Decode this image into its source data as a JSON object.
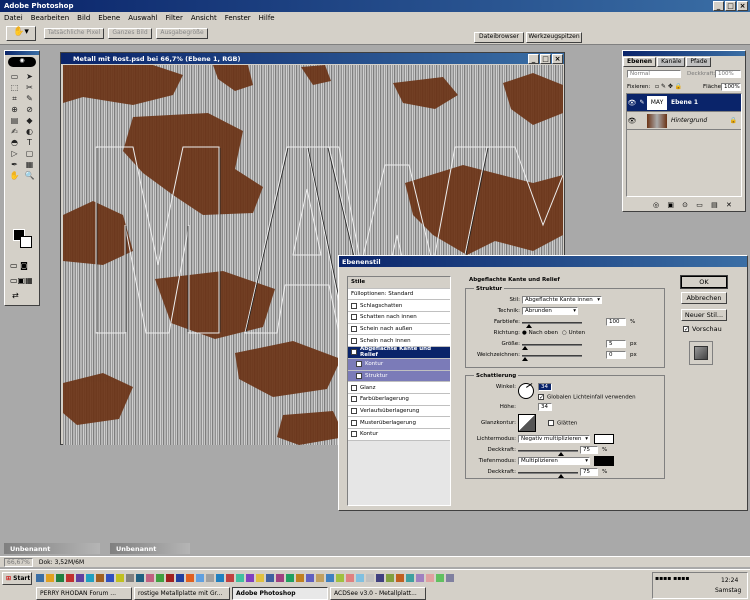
{
  "app": {
    "title": "Adobe Photoshop"
  },
  "menu": [
    "Datei",
    "Bearbeiten",
    "Bild",
    "Ebene",
    "Auswahl",
    "Filter",
    "Ansicht",
    "Fenster",
    "Hilfe"
  ],
  "options": {
    "btn1": "Tatsächliche Pixel",
    "btn2": "Ganzes Bild",
    "btn3": "Ausgabegröße",
    "tab1": "Dateibrowser",
    "tab2": "Werkzeugspitzen"
  },
  "doc": {
    "title": "Metall mit Rost.psd bei 66,7% (Ebene 1, RGB)"
  },
  "layers": {
    "tabs": [
      "Ebenen",
      "Kanäle",
      "Pfade"
    ],
    "mode": "Normal",
    "opacity_label": "Deckkraft:",
    "opacity": "100%",
    "fill_label": "Fläche",
    "fill": "100%",
    "lock_label": "Fixieren:",
    "items": [
      {
        "name": "Ebene 1",
        "thumb": "MAY"
      },
      {
        "name": "Hintergrund"
      }
    ]
  },
  "dialog": {
    "title": "Ebenenstil",
    "styles": [
      {
        "label": "Stile",
        "type": "header"
      },
      {
        "label": "Fülloptionen: Standard",
        "type": "plain"
      },
      {
        "label": "Schlagschatten",
        "type": "check",
        "checked": false
      },
      {
        "label": "Schatten nach innen",
        "type": "check",
        "checked": false
      },
      {
        "label": "Schein nach außen",
        "type": "check",
        "checked": false
      },
      {
        "label": "Schein nach innen",
        "type": "check",
        "checked": false
      },
      {
        "label": "Abgeflachte Kante und Relief",
        "type": "check",
        "checked": true,
        "selected": true
      },
      {
        "label": "Kontur",
        "type": "sub",
        "checked": false
      },
      {
        "label": "Struktur",
        "type": "sub",
        "checked": false
      },
      {
        "label": "Glanz",
        "type": "check",
        "checked": false
      },
      {
        "label": "Farbüberlagerung",
        "type": "check",
        "checked": false
      },
      {
        "label": "Verlaufsüberlagerung",
        "type": "check",
        "checked": false
      },
      {
        "label": "Musterüberlagerung",
        "type": "check",
        "checked": false
      },
      {
        "label": "Kontur",
        "type": "check",
        "checked": false
      }
    ],
    "section_title": "Abgeflachte Kante und Relief",
    "structure": {
      "title": "Struktur",
      "stil_label": "Stil:",
      "stil": "Abgeflachte Kante innen",
      "technik_label": "Technik:",
      "technik": "Abrunden",
      "tiefe_label": "Farbtiefe:",
      "tiefe": "100",
      "richtung_label": "Richtung:",
      "richtung_up": "Nach oben",
      "richtung_down": "Unten",
      "groesse_label": "Größe:",
      "groesse": "5",
      "weich_label": "Weichzeichnen:",
      "weich": "0",
      "px": "px",
      "pct": "%"
    },
    "shading": {
      "title": "Schattierung",
      "winkel_label": "Winkel:",
      "winkel": "34",
      "global_label": "Globalen Lichteinfall verwenden",
      "hoehe_label": "Höhe:",
      "hoehe": "34",
      "glanz_label": "Glanzkontur:",
      "glaetten_label": "Glätten",
      "licht_label": "Lichtermodus:",
      "licht": "Negativ multiplizieren",
      "deck_label": "Deckkraft:",
      "deck1": "75",
      "tiefen_label": "Tiefenmodus:",
      "tiefen": "Multiplizieren",
      "deck2": "75"
    },
    "buttons": {
      "ok": "OK",
      "cancel": "Abbrechen",
      "new_style": "Neuer Stil...",
      "preview": "Vorschau"
    }
  },
  "minimized": [
    "Unbenannt",
    "Unbenannt"
  ],
  "status": {
    "zoom": "66,67%",
    "doc": "Dok: 3,52M/6M"
  },
  "taskbar": {
    "start": "Start",
    "tasks": [
      "PERRY RHODAN Forum ...",
      "rostige Metallplatte mit Gr...",
      "Adobe Photoshop",
      "ACDSee v3.0 - Metallplatt..."
    ],
    "time": "12:24",
    "day": "Samstag"
  }
}
